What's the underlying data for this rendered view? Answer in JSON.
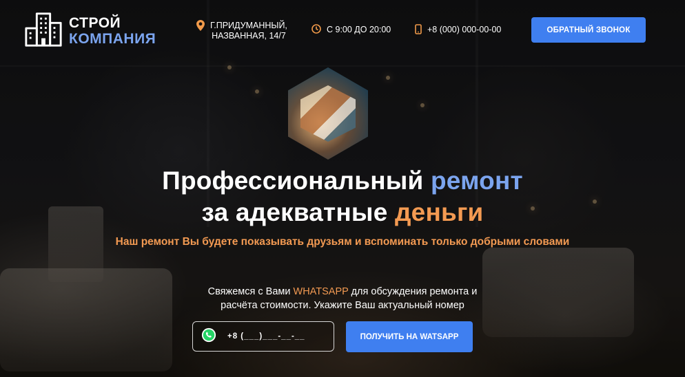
{
  "brand": {
    "line1": "СТРОЙ",
    "line2": "КОМПАНИЯ",
    "logo_icon": "buildings-icon"
  },
  "header": {
    "address_line1": "Г.ПРИДУМАННЫЙ,",
    "address_line2": "НАЗВАННАЯ, 14/7",
    "address_icon": "location-pin-icon",
    "hours": "С 9:00 ДО 20:00",
    "hours_icon": "clock-icon",
    "phone": "+8 (000) 000-00-00",
    "phone_icon": "smartphone-icon",
    "callback_label": "ОБРАТНЫЙ ЗВОНОК"
  },
  "hero": {
    "title_part1": "Профессиональный ",
    "title_accent1": "ремонт",
    "title_part2": "за адекватные ",
    "title_accent2": "деньги",
    "subtitle": "Наш ремонт Вы будете показывать друзьям и вспоминать только добрыми словами",
    "contact_before": "Свяжемся с Вами ",
    "contact_whatsapp": "WHATSAPP",
    "contact_after": " для обсуждения ремонта и",
    "contact_line2": "расчёта стоимости. Укажите Ваш актуальный номер",
    "phone_placeholder": "+8 (___)___-__-__",
    "submit_label": "ПОЛУЧИТЬ НА WATSAPP"
  },
  "colors": {
    "accent_blue": "#7ba4ee",
    "accent_orange": "#f39a52",
    "button_blue": "#3f7ff0"
  }
}
